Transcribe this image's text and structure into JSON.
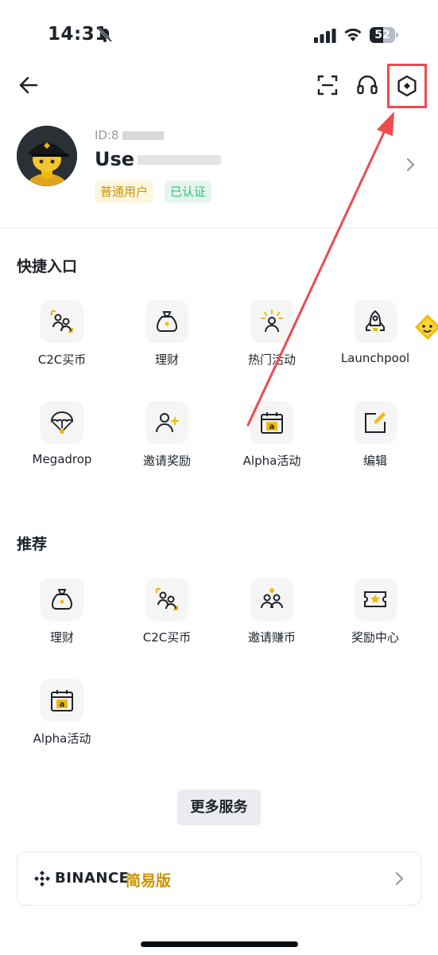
{
  "status_bar": {
    "time": "14:31",
    "battery": "52",
    "battery_level": 0.52
  },
  "profile": {
    "id_prefix": "ID:8",
    "username_visible": "Use",
    "badges": [
      "普通用户",
      "已认证"
    ]
  },
  "quick_entry": {
    "title": "快捷入口",
    "items": [
      {
        "label": "C2C买币",
        "icon": "c2c-icon"
      },
      {
        "label": "理财",
        "icon": "earn-bag-icon"
      },
      {
        "label": "热门活动",
        "icon": "hot-activity-icon"
      },
      {
        "label": "Launchpool",
        "icon": "rocket-icon"
      },
      {
        "label": "Megadrop",
        "icon": "parachute-icon"
      },
      {
        "label": "邀请奖励",
        "icon": "add-user-icon"
      },
      {
        "label": "Alpha活动",
        "icon": "calendar-alpha-icon"
      },
      {
        "label": "编辑",
        "icon": "edit-icon"
      }
    ]
  },
  "recommended": {
    "title": "推荐",
    "items": [
      {
        "label": "理财",
        "icon": "earn-bag-icon"
      },
      {
        "label": "C2C买币",
        "icon": "c2c-icon"
      },
      {
        "label": "邀请赚币",
        "icon": "invite-earn-icon"
      },
      {
        "label": "奖励中心",
        "icon": "ticket-icon"
      },
      {
        "label": "Alpha活动",
        "icon": "calendar-alpha-icon"
      }
    ]
  },
  "more_services": "更多服务",
  "lite_card": {
    "brand": "BINANCE",
    "label": "简易版"
  },
  "colors": {
    "accent": "#F0B90B",
    "gold_text": "#C99400",
    "green": "#2EBD85",
    "annotation_red": "#EE4A4F"
  }
}
